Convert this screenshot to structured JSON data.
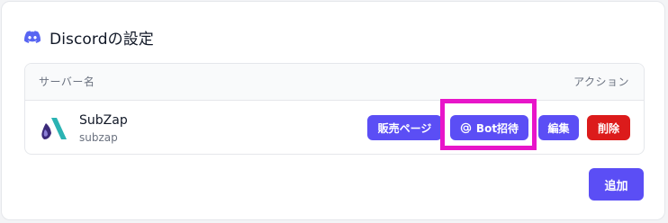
{
  "section": {
    "title": "Discordの設定",
    "icon": "discord-icon"
  },
  "table": {
    "columns": [
      "サーバー名",
      "アクション"
    ],
    "rows": [
      {
        "name": "SubZap",
        "slug": "subzap",
        "logo_icon": "subzap-logo-icon",
        "actions": {
          "sales_page": "販売ページ",
          "bot_invite": "Bot招待",
          "bot_invite_icon": "at-sign-icon",
          "edit": "編集",
          "delete": "削除"
        }
      }
    ]
  },
  "footer": {
    "add_label": "追加"
  },
  "colors": {
    "primary": "#5b4ef5",
    "danger": "#dc1b1b",
    "highlight": "#e815c9",
    "discord_brand": "#5865f2"
  }
}
